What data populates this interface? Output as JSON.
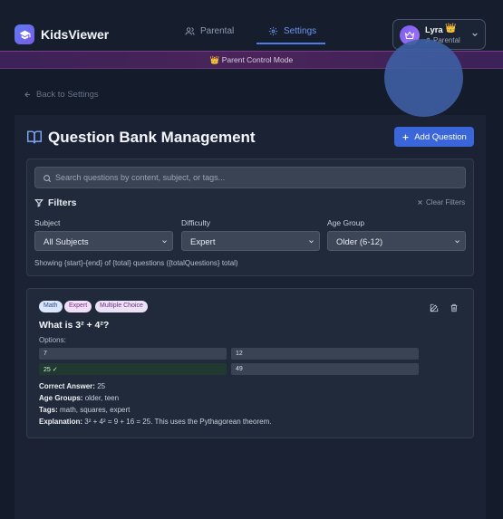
{
  "app": {
    "name": "KidsViewer",
    "nav": [
      {
        "label": "Parental",
        "icon": "users-icon",
        "active": false
      },
      {
        "label": "Settings",
        "icon": "gear-icon",
        "active": true
      }
    ],
    "user": {
      "name": "Lyra",
      "badge": "👑",
      "role": "Parental"
    },
    "accent": "#4f7de8"
  },
  "banner": {
    "text": "👑 Parent Control Mode"
  },
  "back": {
    "label": "Back to Settings"
  },
  "page": {
    "title": "Question Bank Management",
    "add_button": "Add Question"
  },
  "filters": {
    "search_placeholder": "Search questions by content, subject, or tags...",
    "heading": "Filters",
    "clear": "Clear Filters",
    "subject": {
      "label": "Subject",
      "value": "All Subjects"
    },
    "difficulty": {
      "label": "Difficulty",
      "value": "Expert"
    },
    "age_group": {
      "label": "Age Group",
      "value": "Older (6-12)"
    },
    "showing": "Showing {start}-{end} of {total} questions ({totalQuestions} total)"
  },
  "question": {
    "badges": {
      "subject": "Math",
      "difficulty": "Expert",
      "type": "Multiple Choice"
    },
    "text": "What is 3² + 4²?",
    "options_label": "Options:",
    "options": [
      "7",
      "12",
      "25 ✓",
      "49"
    ],
    "correct_label": "Correct Answer:",
    "correct": "25",
    "age_label": "Age Groups:",
    "ages": "older, teen",
    "tags_label": "Tags:",
    "tags": "math, squares, expert",
    "explanation_label": "Explanation:",
    "explanation": "3² + 4² = 9 + 16 = 25. This uses the Pythagorean theorem."
  }
}
